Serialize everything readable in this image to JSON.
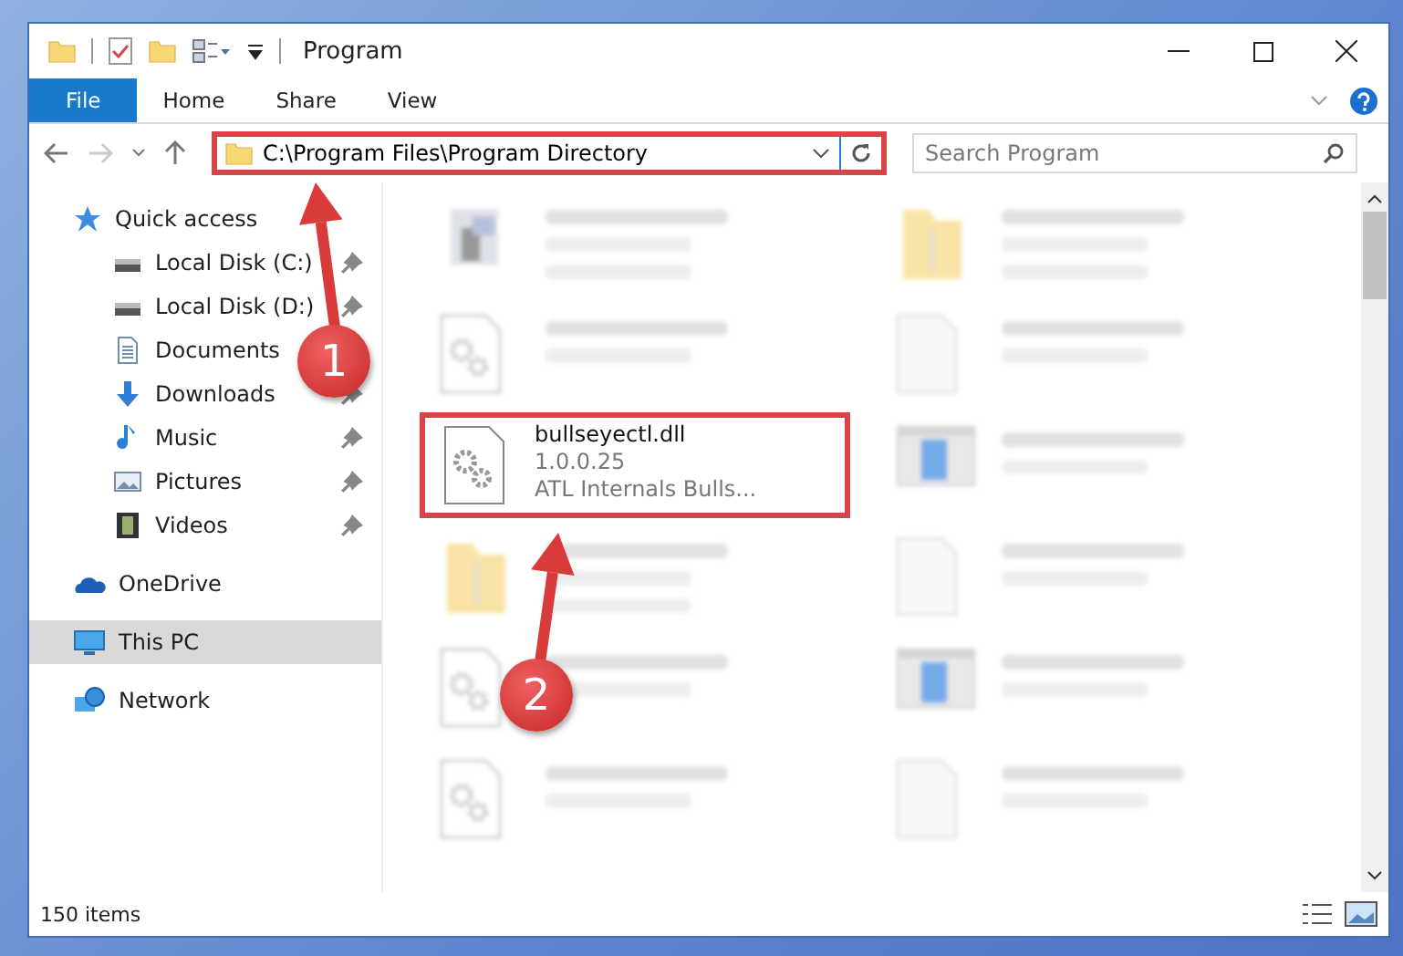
{
  "window": {
    "title": "Program"
  },
  "ribbon_tabs": [
    {
      "label": "File",
      "selected": true
    },
    {
      "label": "Home",
      "selected": false
    },
    {
      "label": "Share",
      "selected": false
    },
    {
      "label": "View",
      "selected": false
    }
  ],
  "address": {
    "path": "C:\\Program Files\\Program Directory",
    "highlighted": true
  },
  "search": {
    "placeholder": "Search Program"
  },
  "sidebar": {
    "items": [
      {
        "label": "Quick access",
        "kind": "quick",
        "selected": false,
        "children": [
          {
            "label": "Local Disk (C:)",
            "kind": "disk",
            "selected": false,
            "pinned": true
          },
          {
            "label": "Local Disk (D:)",
            "kind": "disk",
            "selected": false,
            "pinned": true
          },
          {
            "label": "Documents",
            "kind": "documents",
            "selected": false,
            "pinned": false
          },
          {
            "label": "Downloads",
            "kind": "downloads",
            "selected": false,
            "pinned": true
          },
          {
            "label": "Music",
            "kind": "music",
            "selected": false,
            "pinned": true
          },
          {
            "label": "Pictures",
            "kind": "pictures",
            "selected": false,
            "pinned": true
          },
          {
            "label": "Videos",
            "kind": "videos",
            "selected": false,
            "pinned": true
          }
        ]
      },
      {
        "label": "OneDrive",
        "kind": "cloud",
        "selected": false
      },
      {
        "label": "This PC",
        "kind": "pc",
        "selected": true
      },
      {
        "label": "Network",
        "kind": "network",
        "selected": false
      }
    ]
  },
  "files": [
    {
      "kind": "exe",
      "blurred": true,
      "highlighted": false
    },
    {
      "kind": "folder",
      "blurred": true,
      "highlighted": false
    },
    {
      "kind": "dll",
      "blurred": true,
      "highlighted": false
    },
    {
      "kind": "blank",
      "blurred": true,
      "highlighted": false
    },
    {
      "name": "bullseyectl.dll",
      "details": [
        "1.0.0.25",
        "ATL Internals Bulls..."
      ],
      "kind": "dll",
      "blurred": false,
      "highlighted": true
    },
    {
      "kind": "installer",
      "blurred": true,
      "highlighted": false
    },
    {
      "kind": "folder",
      "blurred": true,
      "highlighted": false
    },
    {
      "kind": "blank",
      "blurred": true,
      "highlighted": false
    },
    {
      "kind": "dll",
      "blurred": true,
      "highlighted": false
    },
    {
      "kind": "installer",
      "blurred": true,
      "highlighted": false
    },
    {
      "kind": "dll",
      "blurred": true,
      "highlighted": false
    },
    {
      "kind": "blank",
      "blurred": true,
      "highlighted": false
    }
  ],
  "annotations": [
    {
      "label": "1"
    },
    {
      "label": "2"
    }
  ],
  "status_bar": {
    "item_count": "150 items"
  }
}
